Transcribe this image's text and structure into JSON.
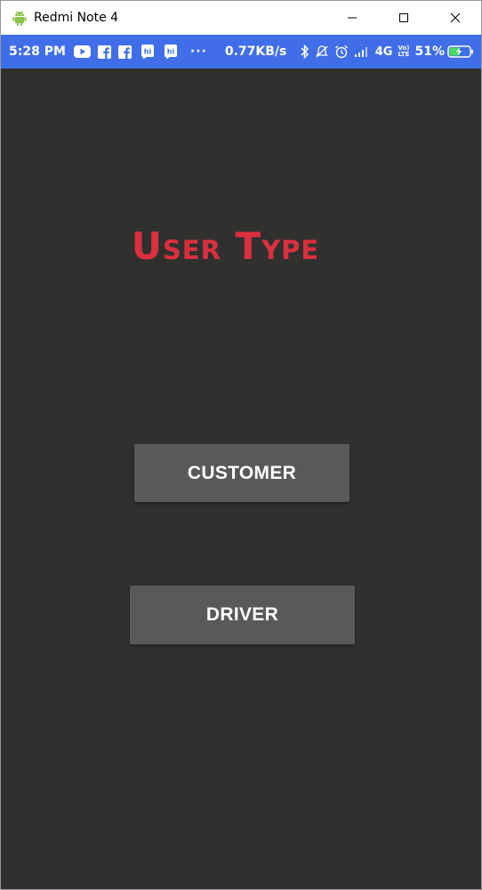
{
  "window": {
    "title": "Redmi Note 4",
    "icons": {
      "app": "android-icon",
      "minimize": "minimize-icon",
      "maximize": "maximize-icon",
      "close": "close-icon"
    }
  },
  "statusbar": {
    "time": "5:28 PM",
    "notification_icons": [
      "youtube-icon",
      "facebook-icon",
      "facebook-icon",
      "hike-icon",
      "hike-icon"
    ],
    "more": "···",
    "speed": "0.77KB/s",
    "network": "4G",
    "volte_top": "Vo)",
    "volte_bottom": "LTE",
    "battery_percent": "51%",
    "colors": {
      "background": "#3f6ee8",
      "battery_fill": "#4cd964"
    }
  },
  "app": {
    "title": "User Type",
    "buttons": {
      "customer": "CUSTOMER",
      "driver": "DRIVER"
    },
    "colors": {
      "background": "#30312f",
      "title": "#dc2f3e",
      "button": "#585958"
    }
  }
}
